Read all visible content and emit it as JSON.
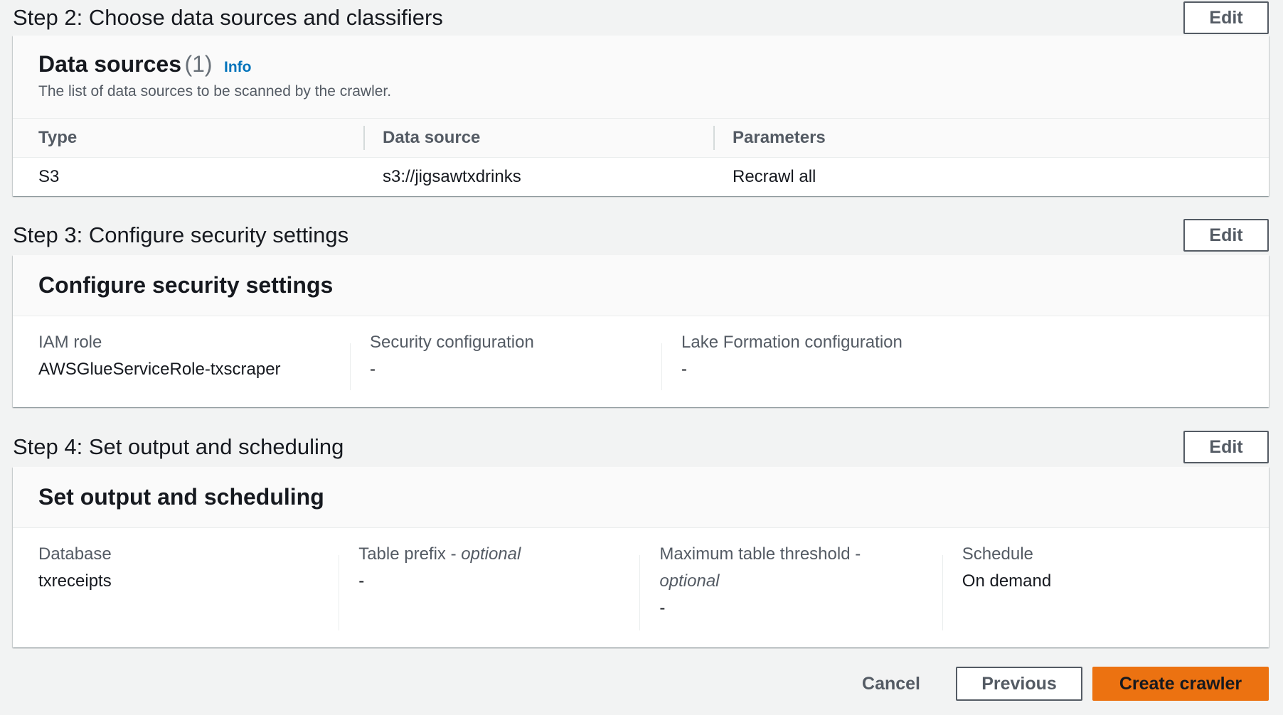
{
  "step2": {
    "title": "Step 2: Choose data sources and classifiers",
    "edit_label": "Edit",
    "card": {
      "title": "Data sources",
      "count": "(1)",
      "info": "Info",
      "description": "The list of data sources to be scanned by the crawler.",
      "columns": [
        "Type",
        "Data source",
        "Parameters"
      ],
      "rows": [
        [
          "S3",
          "s3://jigsawtxdrinks",
          "Recrawl all"
        ]
      ]
    }
  },
  "step3": {
    "title": "Step 3: Configure security settings",
    "edit_label": "Edit",
    "card": {
      "title": "Configure security settings",
      "fields": [
        {
          "label": "IAM role",
          "value": "AWSGlueServiceRole-txscraper"
        },
        {
          "label": "Security configuration",
          "value": "-"
        },
        {
          "label": "Lake Formation configuration",
          "value": "-"
        }
      ]
    }
  },
  "step4": {
    "title": "Step 4: Set output and scheduling",
    "edit_label": "Edit",
    "card": {
      "title": "Set output and scheduling",
      "fields": [
        {
          "label": "Database",
          "value": "txreceipts"
        },
        {
          "label": "Table prefix - ",
          "optional": "optional",
          "value": "-"
        },
        {
          "label": "Maximum table threshold - ",
          "optional": "optional",
          "value": "-"
        },
        {
          "label": "Schedule",
          "value": "On demand"
        }
      ]
    }
  },
  "footer": {
    "cancel": "Cancel",
    "previous": "Previous",
    "create": "Create crawler"
  },
  "colors": {
    "primary": "#ec7211",
    "link": "#0073bb",
    "background": "#f2f3f3"
  }
}
